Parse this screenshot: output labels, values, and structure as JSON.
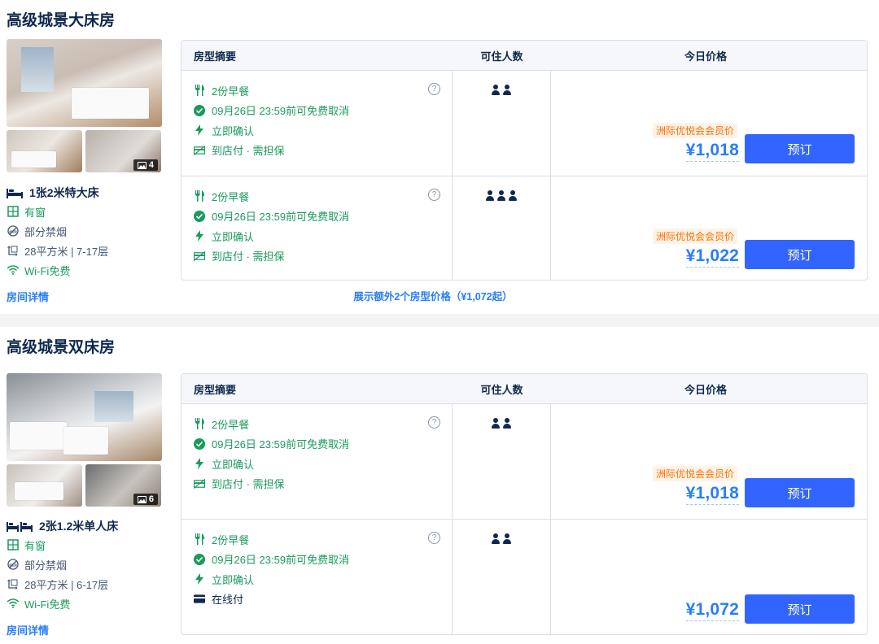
{
  "colors": {
    "accent": "#287dfa",
    "button": "#3264ff",
    "green": "#1a9a5c",
    "orange": "#ff6f00",
    "text": "#0f294d"
  },
  "table_headers": {
    "summary": "房型摘要",
    "guests": "可住人数",
    "price": "今日价格"
  },
  "rooms": [
    {
      "title": "高级城景大床房",
      "photo_count": "4",
      "bed": "1张2米特大床",
      "window": "有窗",
      "smoking": "部分禁烟",
      "area": "28平方米 | 7-17层",
      "wifi": "Wi-Fi免费",
      "detail_link": "房间详情",
      "rates": [
        {
          "breakfast": "2份早餐",
          "cancel": "09月26日 23:59前可免费取消",
          "confirm": "立即确认",
          "payment": "到店付 · 需担保",
          "guests": 2,
          "member_tag": "洲际优悦会会员价",
          "price": "¥1,018",
          "book": "预订"
        },
        {
          "breakfast": "2份早餐",
          "cancel": "09月26日 23:59前可免费取消",
          "confirm": "立即确认",
          "payment": "到店付 · 需担保",
          "guests": 3,
          "member_tag": "洲际优悦会会员价",
          "price": "¥1,022",
          "book": "预订"
        }
      ],
      "more_link": "展示额外2个房型价格（¥1,072起）"
    },
    {
      "title": "高级城景双床房",
      "photo_count": "6",
      "bed": "2张1.2米单人床",
      "window": "有窗",
      "smoking": "部分禁烟",
      "area": "28平方米 | 6-17层",
      "wifi": "Wi-Fi免费",
      "detail_link": "房间详情",
      "rates": [
        {
          "breakfast": "2份早餐",
          "cancel": "09月26日 23:59前可免费取消",
          "confirm": "立即确认",
          "payment": "到店付 · 需担保",
          "guests": 2,
          "member_tag": "洲际优悦会会员价",
          "price": "¥1,018",
          "book": "预订"
        },
        {
          "breakfast": "2份早餐",
          "cancel": "09月26日 23:59前可免费取消",
          "confirm": "立即确认",
          "payment": "在线付",
          "guests": 2,
          "price": "¥1,072",
          "book": "预订"
        }
      ]
    }
  ]
}
